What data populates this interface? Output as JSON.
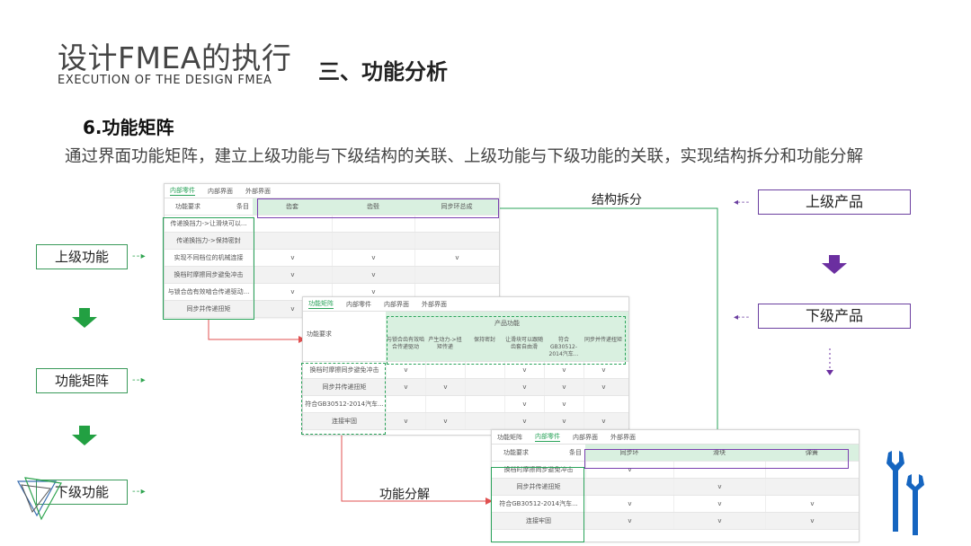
{
  "header": {
    "title": "设计FMEA的执行",
    "subtitle": "EXECUTION OF THE DESIGN FMEA",
    "section": "三、功能分析"
  },
  "heading": "6.功能矩阵",
  "description": "通过界面功能矩阵，建立上级功能与下级结构的关联、上级功能与下级功能的关联，实现结构拆分和功能分解",
  "left_flow": [
    "上级功能",
    "功能矩阵",
    "下级功能"
  ],
  "right_flow": [
    "上级产品",
    "下级产品"
  ],
  "labels": {
    "structure_split": "结构拆分",
    "function_decompose": "功能分解"
  },
  "matrix1": {
    "tabs": [
      "内部零件",
      "内部界面",
      "外部界面"
    ],
    "header_left": "功能要求",
    "header_item": "条目",
    "columns": [
      "齿套",
      "齿毂",
      "同步环总成"
    ],
    "rows": [
      {
        "label": "传递换挡力->让滑块可以...",
        "v": [
          "",
          "",
          ""
        ]
      },
      {
        "label": "传递换挡力->保持密封",
        "v": [
          "",
          "",
          ""
        ]
      },
      {
        "label": "实现不同档位的机械连接",
        "v": [
          "v",
          "v",
          "v"
        ]
      },
      {
        "label": "换档时摩擦同步避免冲击",
        "v": [
          "v",
          "v",
          ""
        ]
      },
      {
        "label": "与锁合齿有效啮合传递驱动...",
        "v": [
          "v",
          "v",
          ""
        ]
      },
      {
        "label": "同步并传递扭矩",
        "v": [
          "v",
          "",
          ""
        ]
      }
    ]
  },
  "matrix2": {
    "tabs": [
      "功能矩阵",
      "内部零件",
      "内部界面",
      "外部界面"
    ],
    "header_left": "功能要求",
    "header_group": "产品功能",
    "columns": [
      "与锁合齿有效啮合传递驱动",
      "产生动力->扭矩传递",
      "保持密封",
      "让滑块可以跟随齿套自由滑",
      "符合GB30512-2014汽车...",
      "同步并传递扭矩"
    ],
    "rows": [
      {
        "label": "换档时摩擦同步避免冲击",
        "v": [
          "v",
          "",
          "",
          "v",
          "v",
          "v"
        ]
      },
      {
        "label": "同步并传递扭矩",
        "v": [
          "v",
          "v",
          "",
          "v",
          "v",
          "v"
        ]
      },
      {
        "label": "符合GB30512-2014汽车...",
        "v": [
          "",
          "",
          "",
          "v",
          "v",
          ""
        ]
      },
      {
        "label": "连接牢固",
        "v": [
          "v",
          "v",
          "",
          "v",
          "v",
          "v"
        ]
      }
    ]
  },
  "matrix3": {
    "tabs": [
      "功能矩阵",
      "内部零件",
      "内部界面",
      "外部界面"
    ],
    "header_left": "功能要求",
    "header_item": "条目",
    "columns": [
      "同步环",
      "滑块",
      "弹簧"
    ],
    "rows": [
      {
        "label": "换档时摩擦同步避免冲击",
        "v": [
          "v",
          "",
          ""
        ]
      },
      {
        "label": "同步并传递扭矩",
        "v": [
          "",
          "v",
          ""
        ]
      },
      {
        "label": "符合GB30512-2014汽车...",
        "v": [
          "v",
          "v",
          "v"
        ]
      },
      {
        "label": "连接牢固",
        "v": [
          "v",
          "v",
          "v"
        ]
      }
    ]
  },
  "colors": {
    "green": "#22a042",
    "purple": "#6b2fa0",
    "blue_icon": "#1565c0"
  }
}
